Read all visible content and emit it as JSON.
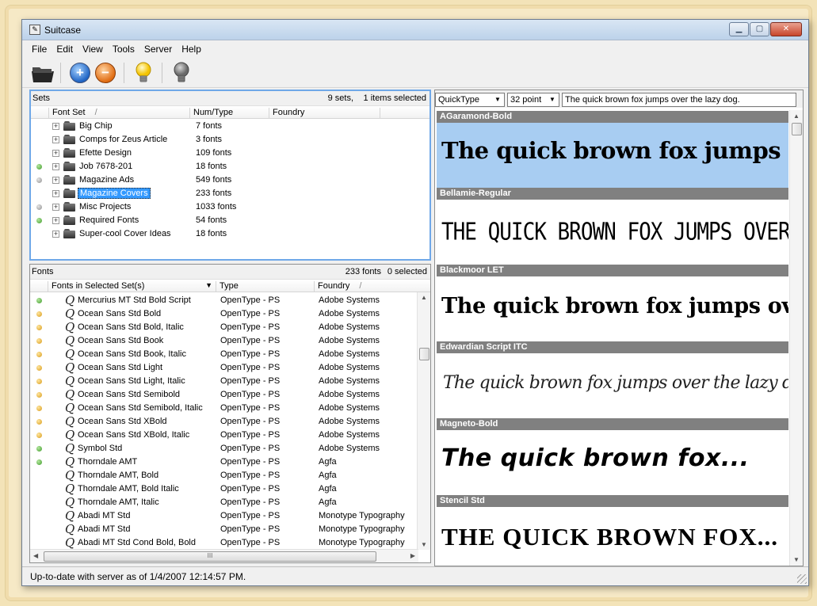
{
  "window": {
    "title": "Suitcase"
  },
  "menu": [
    "File",
    "Edit",
    "View",
    "Tools",
    "Server",
    "Help"
  ],
  "toolbar": {
    "icons": [
      "open-folder-icon",
      "add-icon",
      "remove-icon",
      "activate-bulb-icon",
      "deactivate-bulb-icon"
    ],
    "add_glyph": "+",
    "remove_glyph": "−"
  },
  "sets_pane": {
    "label": "Sets",
    "count": "9 sets,",
    "selected": "1 items selected",
    "columns": [
      "Font Set",
      "Num/Type",
      "Foundry"
    ],
    "sort_glyph": "/",
    "expander_glyph": "+",
    "rows": [
      {
        "name": "Big Chip",
        "num": "7 fonts",
        "status": "none"
      },
      {
        "name": "Comps for Zeus Article",
        "num": "3 fonts",
        "status": "none"
      },
      {
        "name": "Efette Design",
        "num": "109 fonts",
        "status": "none"
      },
      {
        "name": "Job 7678-201",
        "num": "18 fonts",
        "status": "green"
      },
      {
        "name": "Magazine Ads",
        "num": "549 fonts",
        "status": "gray"
      },
      {
        "name": "Magazine Covers",
        "num": "233 fonts",
        "status": "none",
        "selected": true
      },
      {
        "name": "Misc Projects",
        "num": "1033 fonts",
        "status": "gray"
      },
      {
        "name": "Required Fonts",
        "num": "54 fonts",
        "status": "green"
      },
      {
        "name": "Super-cool Cover Ideas",
        "num": "18 fonts",
        "status": "none"
      }
    ]
  },
  "fonts_pane": {
    "label": "Fonts",
    "count": "233 fonts",
    "selected": "0 selected",
    "columns": [
      "Fonts in Selected Set(s)",
      "Type",
      "Foundry"
    ],
    "sort_glyph": "/",
    "icon_glyph": "Q",
    "rows": [
      {
        "name": "Mercurius MT Std Bold Script",
        "type": "OpenType - PS",
        "foundry": "Adobe Systems",
        "status": "green"
      },
      {
        "name": "Ocean Sans Std Bold",
        "type": "OpenType - PS",
        "foundry": "Adobe Systems",
        "status": "amber"
      },
      {
        "name": "Ocean Sans Std Bold, Italic",
        "type": "OpenType - PS",
        "foundry": "Adobe Systems",
        "status": "amber"
      },
      {
        "name": "Ocean Sans Std Book",
        "type": "OpenType - PS",
        "foundry": "Adobe Systems",
        "status": "amber"
      },
      {
        "name": "Ocean Sans Std Book, Italic",
        "type": "OpenType - PS",
        "foundry": "Adobe Systems",
        "status": "amber"
      },
      {
        "name": "Ocean Sans Std Light",
        "type": "OpenType - PS",
        "foundry": "Adobe Systems",
        "status": "amber"
      },
      {
        "name": "Ocean Sans Std Light, Italic",
        "type": "OpenType - PS",
        "foundry": "Adobe Systems",
        "status": "amber"
      },
      {
        "name": "Ocean Sans Std Semibold",
        "type": "OpenType - PS",
        "foundry": "Adobe Systems",
        "status": "amber"
      },
      {
        "name": "Ocean Sans Std Semibold, Italic",
        "type": "OpenType - PS",
        "foundry": "Adobe Systems",
        "status": "amber"
      },
      {
        "name": "Ocean Sans Std XBold",
        "type": "OpenType - PS",
        "foundry": "Adobe Systems",
        "status": "amber"
      },
      {
        "name": "Ocean Sans Std XBold, Italic",
        "type": "OpenType - PS",
        "foundry": "Adobe Systems",
        "status": "amber"
      },
      {
        "name": "Symbol Std",
        "type": "OpenType - PS",
        "foundry": "Adobe Systems",
        "status": "green"
      },
      {
        "name": "Thorndale AMT",
        "type": "OpenType - PS",
        "foundry": "Agfa",
        "status": "green"
      },
      {
        "name": "Thorndale AMT, Bold",
        "type": "OpenType - PS",
        "foundry": "Agfa",
        "status": "none"
      },
      {
        "name": "Thorndale AMT, Bold Italic",
        "type": "OpenType - PS",
        "foundry": "Agfa",
        "status": "none"
      },
      {
        "name": "Thorndale AMT, Italic",
        "type": "OpenType - PS",
        "foundry": "Agfa",
        "status": "none"
      },
      {
        "name": "Abadi MT Std",
        "type": "OpenType - PS",
        "foundry": "Monotype Typography",
        "status": "none"
      },
      {
        "name": "Abadi MT Std",
        "type": "OpenType - PS",
        "foundry": "Monotype Typography",
        "status": "none"
      },
      {
        "name": "Abadi MT Std Cond Bold, Bold",
        "type": "OpenType - PS",
        "foundry": "Monotype Typography",
        "status": "none"
      }
    ],
    "hscroll_grip": "III"
  },
  "preview_pane": {
    "mode": "QuickType",
    "size": "32 point",
    "text": "The quick brown fox jumps over the lazy dog.",
    "samples": [
      {
        "font": "AGaramond-Bold",
        "sample": "The quick brown fox jumps over...",
        "selected": true
      },
      {
        "font": "Bellamie-Regular",
        "sample": "THE QUICK BROWN FOX JUMPS OVER..."
      },
      {
        "font": "Blackmoor LET",
        "sample": "The quick brown fox jumps over..."
      },
      {
        "font": "Edwardian Script ITC",
        "sample": "The quick brown fox jumps over the lazy dog."
      },
      {
        "font": "Magneto-Bold",
        "sample": "The quick brown fox..."
      },
      {
        "font": "Stencil Std",
        "sample": "THE QUICK BROWN FOX..."
      }
    ]
  },
  "status_bar": {
    "text": "Up-to-date with server as of 1/4/2007 12:14:57 PM."
  },
  "colors": {
    "selection": "#3399ff",
    "sample_selected": "#a8cdf2",
    "sample_header": "#808080",
    "active_green": "#3f9a2a",
    "partial_amber": "#d89a18",
    "inactive_gray": "#8f8f8f"
  }
}
